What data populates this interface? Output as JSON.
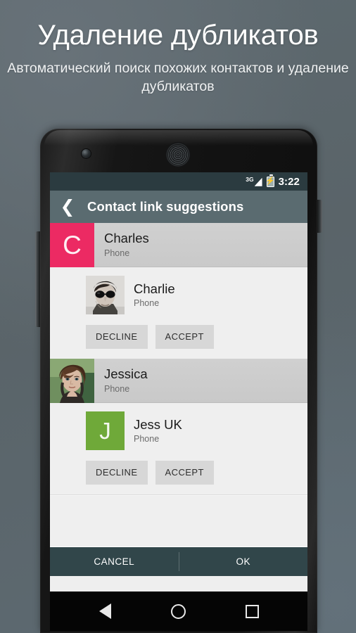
{
  "promo": {
    "title": "Удаление дубликатов",
    "subtitle": "Автоматический поиск похожих контактов и удаление дубликатов"
  },
  "colors": {
    "promo_background": "#5c666b",
    "status_bar": "#2b3b40",
    "app_bar": "#5a6b70",
    "action_bar": "#31464a",
    "group_header": "#cccccc",
    "group_body": "#efefef",
    "flat_button": "#d7d7d7",
    "avatar_pink": "#ec2a63",
    "avatar_green": "#6fa939",
    "nav_bar": "#050505"
  },
  "status_bar": {
    "network_label": "3G",
    "network_icon": "signal-bars-icon",
    "battery_icon": "battery-charging-icon",
    "clock": "3:22"
  },
  "app_bar": {
    "back_icon": "chevron-left-icon",
    "title": "Contact link suggestions"
  },
  "groups": [
    {
      "header": {
        "name": "Charles",
        "account": "Phone",
        "avatar_kind": "letter",
        "avatar_letter": "C",
        "avatar_color": "#ec2a63"
      },
      "candidate": {
        "name": "Charlie",
        "account": "Phone",
        "avatar_kind": "photo",
        "avatar_photo": "photo-man-sunglasses"
      },
      "buttons": {
        "decline": "DECLINE",
        "accept": "ACCEPT"
      }
    },
    {
      "header": {
        "name": "Jessica",
        "account": "Phone",
        "avatar_kind": "photo",
        "avatar_photo": "photo-woman-bob-hair"
      },
      "candidate": {
        "name": "Jess UK",
        "account": "Phone",
        "avatar_kind": "letter",
        "avatar_letter": "J",
        "avatar_color": "#6fa939"
      },
      "buttons": {
        "decline": "DECLINE",
        "accept": "ACCEPT"
      }
    }
  ],
  "action_bar": {
    "cancel": "CANCEL",
    "ok": "OK"
  },
  "nav_bar": {
    "back_icon": "triangle-back-icon",
    "home_icon": "circle-home-icon",
    "recents_icon": "square-recents-icon"
  },
  "device": {
    "camera_icon": "front-camera-icon",
    "speaker_icon": "earpiece-speaker-icon",
    "power_button": "power-button",
    "volume_button": "volume-button"
  }
}
